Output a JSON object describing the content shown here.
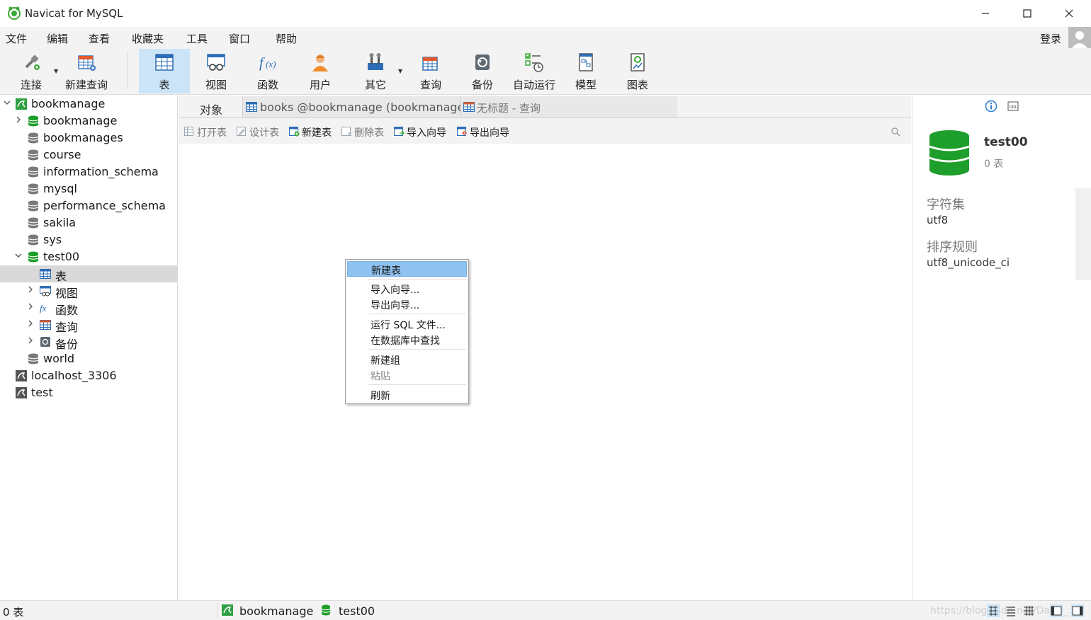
{
  "window": {
    "title": "Navicat for MySQL",
    "login": "登录"
  },
  "menu": [
    "文件",
    "编辑",
    "查看",
    "收藏夹",
    "工具",
    "窗口",
    "帮助"
  ],
  "toolbar": {
    "connect": "连接",
    "new_query": "新建查询",
    "table": "表",
    "view": "视图",
    "function": "函数",
    "user": "用户",
    "other": "其它",
    "query": "查询",
    "backup": "备份",
    "automation": "自动运行",
    "model": "模型",
    "chart": "图表"
  },
  "tree": [
    {
      "label": "bookmanage"
    },
    {
      "label": "bookmanage"
    },
    {
      "label": "bookmanages"
    },
    {
      "label": "course"
    },
    {
      "label": "information_schema"
    },
    {
      "label": "mysql"
    },
    {
      "label": "performance_schema"
    },
    {
      "label": "sakila"
    },
    {
      "label": "sys"
    },
    {
      "label": "test00"
    },
    {
      "label": "表"
    },
    {
      "label": "视图"
    },
    {
      "label": "函数"
    },
    {
      "label": "查询"
    },
    {
      "label": "备份"
    },
    {
      "label": "world"
    },
    {
      "label": "localhost_3306"
    },
    {
      "label": "test"
    }
  ],
  "tabs": {
    "objects": "对象",
    "books": "books @bookmanage (bookmanage...",
    "query": "无标题 - 查询"
  },
  "object_toolbar": {
    "open": "打开表",
    "design": "设计表",
    "new": "新建表",
    "delete": "删除表",
    "import": "导入向导",
    "export": "导出向导"
  },
  "context_menu": {
    "new_table": "新建表",
    "import_wizard": "导入向导...",
    "export_wizard": "导出向导...",
    "run_sql": "运行 SQL 文件...",
    "find_in_db": "在数据库中查找",
    "new_group": "新建组",
    "paste": "粘贴",
    "refresh": "刷新"
  },
  "info": {
    "db_name": "test00",
    "table_count": "0 表",
    "charset_label": "字符集",
    "charset_value": "utf8",
    "collation_label": "排序规则",
    "collation_value": "utf8_unicode_ci"
  },
  "status": {
    "count": "0 表",
    "connection": "bookmanage",
    "database": "test00",
    "watermark": "https://blog.csdn.net/Daisy_..."
  },
  "colors": {
    "accent": "#cce4f7",
    "db_green": "#1e9e2a",
    "menu_highlight": "#8fc2f0"
  }
}
